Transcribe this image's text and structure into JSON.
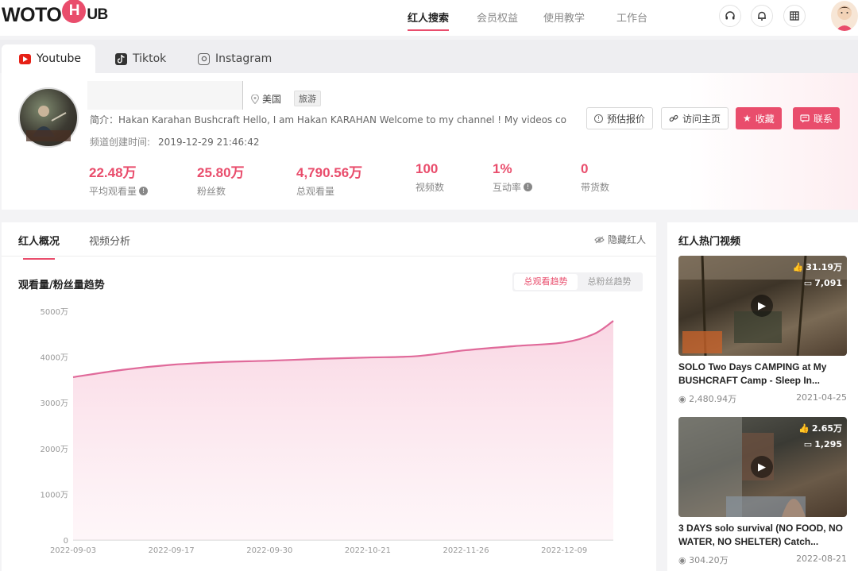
{
  "brand": {
    "logo_left": "WOTO",
    "logo_mid": "H",
    "logo_right": "UB",
    "accent": "#e94d6c"
  },
  "nav": [
    {
      "label": "红人搜索",
      "active": true
    },
    {
      "label": "会员权益",
      "active": false
    },
    {
      "label": "使用教学",
      "active": false
    },
    {
      "label": "工作台",
      "active": false
    }
  ],
  "header_icons": [
    "headset-icon",
    "bell-icon",
    "grid-icon",
    "user-avatar"
  ],
  "platforms": [
    {
      "label": "Youtube",
      "active": true,
      "icon": "youtube-icon"
    },
    {
      "label": "Tiktok",
      "active": false,
      "icon": "tiktok-icon"
    },
    {
      "label": "Instagram",
      "active": false,
      "icon": "instagram-icon"
    }
  ],
  "profile": {
    "location": "美国",
    "category": "旅游",
    "description": "简介：Hakan Karahan Bushcraft Hello, I am Hakan KARAHAN Welcome to my channel ! My videos cov...",
    "created_label": "频道创建时间:",
    "created_value": "2019-12-29 21:46:42",
    "buttons": {
      "estimate": "预估报价",
      "visit": "访问主页",
      "favorite": "收藏",
      "contact": "联系"
    },
    "stats": [
      {
        "value": "22.48万",
        "label": "平均观看量",
        "info": true
      },
      {
        "value": "25.80万",
        "label": "粉丝数",
        "info": false
      },
      {
        "value": "4,790.56万",
        "label": "总观看量",
        "info": false
      },
      {
        "value": "100",
        "label": "视频数",
        "info": false
      },
      {
        "value": "1%",
        "label": "互动率",
        "info": true
      },
      {
        "value": "0",
        "label": "带货数",
        "info": false
      }
    ]
  },
  "main": {
    "tabs": [
      {
        "label": "红人概况",
        "active": true
      },
      {
        "label": "视频分析",
        "active": false
      }
    ],
    "hide_label": "隐藏红人",
    "chart_title": "观看量/粉丝量趋势",
    "toggle": {
      "on": "总观看趋势",
      "off": "总粉丝趋势"
    }
  },
  "chart_data": {
    "type": "area",
    "title": "观看量/粉丝量趋势",
    "ylim": [
      0,
      5000
    ],
    "y_ticks": [
      "0",
      "1000万",
      "2000万",
      "3000万",
      "4000万",
      "5000万"
    ],
    "x_labels": [
      "2022-09-03",
      "2022-09-17",
      "2022-09-30",
      "2022-10-21",
      "2022-11-26",
      "2022-12-09"
    ],
    "x": [
      0,
      0.5,
      1,
      1.5,
      2,
      2.5,
      3,
      3.5,
      4,
      4.5,
      5,
      5.3,
      5.5
    ],
    "series": [
      {
        "values": [
          3560,
          3720,
          3830,
          3890,
          3920,
          3960,
          3990,
          4020,
          4150,
          4240,
          4320,
          4500,
          4790
        ]
      }
    ],
    "line_color": "#e06a9a",
    "grid": false
  },
  "side": {
    "title": "红人热门视频",
    "videos": [
      {
        "likes": "31.19万",
        "comments": "7,091",
        "title": "SOLO Two Days CAMPING at My BUSHCRAFT Camp - Sleep In...",
        "views": "2,480.94万",
        "date": "2021-04-25"
      },
      {
        "likes": "2.65万",
        "comments": "1,295",
        "title": "3 DAYS solo survival (NO FOOD, NO WATER, NO SHELTER) Catch...",
        "views": "304.20万",
        "date": "2022-08-21"
      }
    ]
  }
}
